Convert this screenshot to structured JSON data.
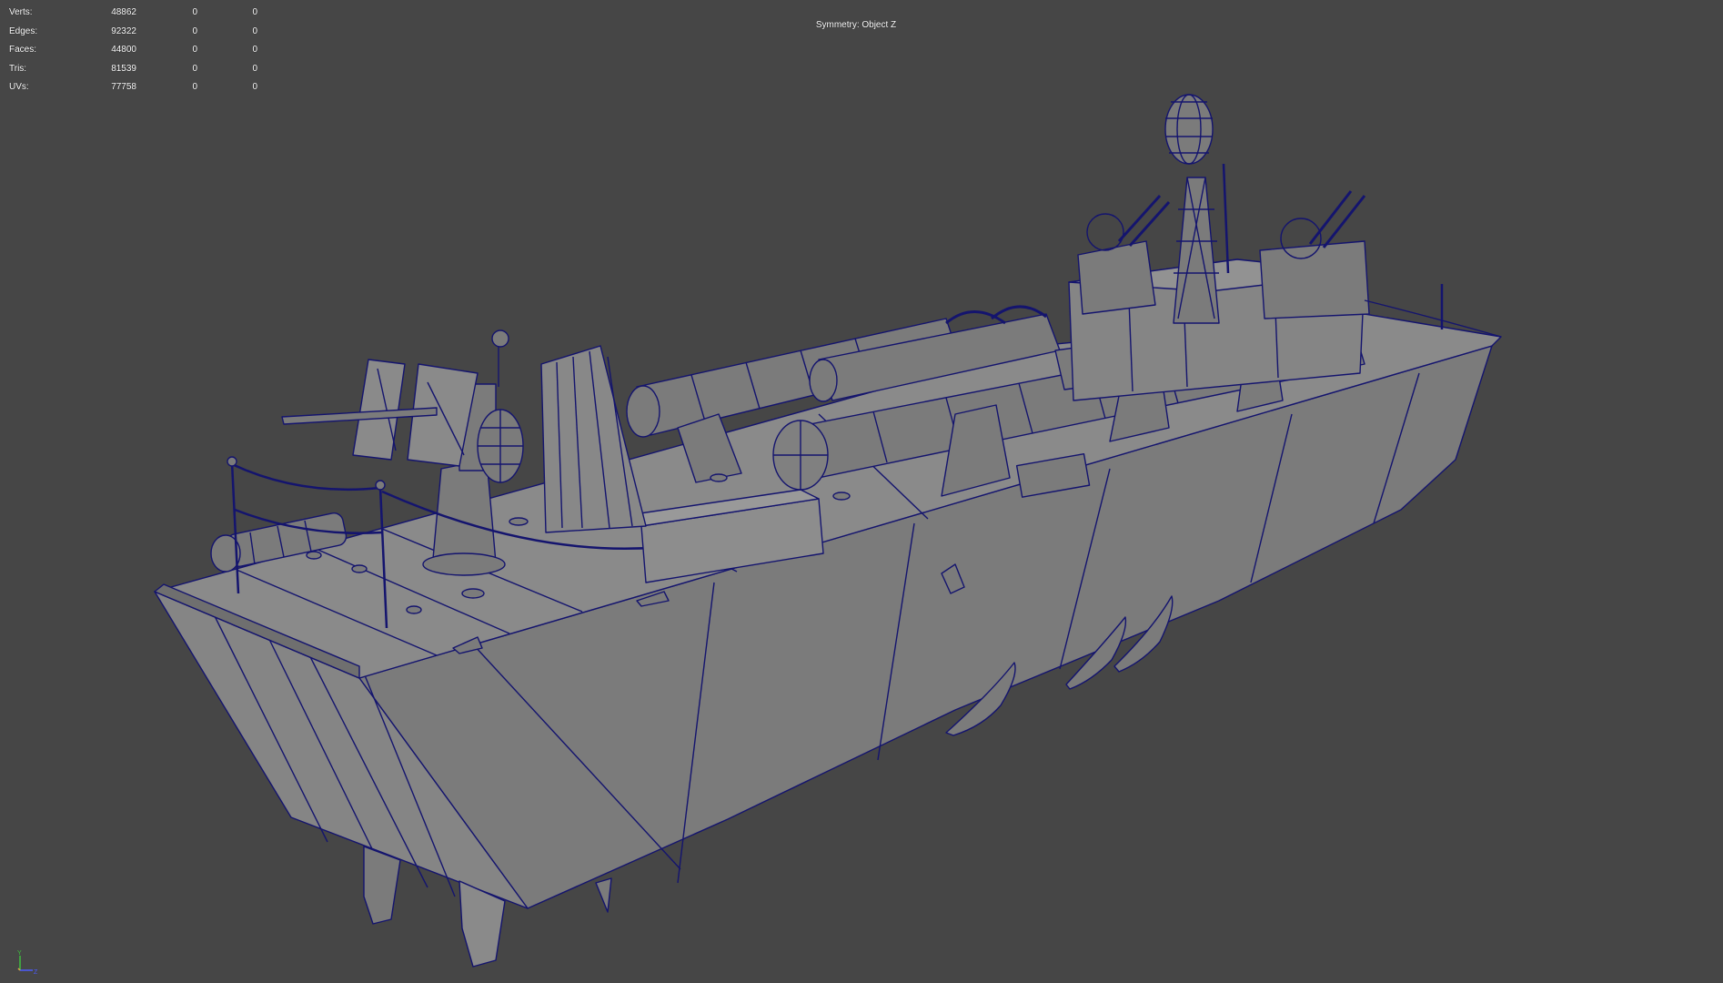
{
  "hud": {
    "rows": [
      {
        "label": "Verts:",
        "value": "48862",
        "selected": "0",
        "uv": "0"
      },
      {
        "label": "Edges:",
        "value": "92322",
        "selected": "0",
        "uv": "0"
      },
      {
        "label": "Faces:",
        "value": "44800",
        "selected": "0",
        "uv": "0"
      },
      {
        "label": "Tris:",
        "value": "81539",
        "selected": "0",
        "uv": "0"
      },
      {
        "label": "UVs:",
        "value": "77758",
        "selected": "0",
        "uv": "0"
      }
    ]
  },
  "viewport": {
    "symmetry_label": "Symmetry: Object Z"
  },
  "axis": {
    "y_label": "Y",
    "z_label": "Z"
  },
  "colors": {
    "background": "#464646",
    "mesh_fill": "#7a7a7a",
    "wireframe": "#14146e",
    "axis_y": "#3fbf3f",
    "axis_z": "#4b5bff",
    "axis_x": "#d8a84a"
  }
}
